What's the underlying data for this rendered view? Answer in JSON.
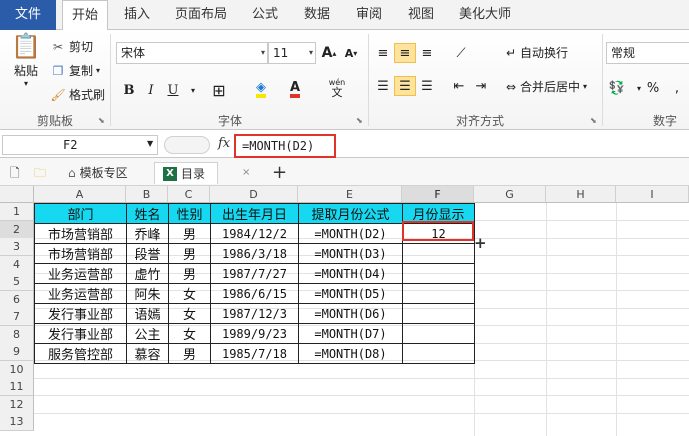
{
  "tabs": [
    "文件",
    "开始",
    "插入",
    "页面布局",
    "公式",
    "数据",
    "审阅",
    "视图",
    "美化大师"
  ],
  "clipboard": {
    "paste": "粘贴",
    "cut": "剪切",
    "copy": "复制",
    "format_painter": "格式刷",
    "label": "剪贴板"
  },
  "font": {
    "name": "宋体",
    "size": "11",
    "label": "字体",
    "bold": "B",
    "italic": "I",
    "underline": "U",
    "grow": "A",
    "shrink": "A",
    "wen": "wén"
  },
  "alignment": {
    "wrap": "自动换行",
    "merge": "合并后居中",
    "label": "对齐方式"
  },
  "number": {
    "format": "常规",
    "percent": "%",
    "comma": ",",
    "label": "数字"
  },
  "formula_bar": {
    "name_box": "F2",
    "fx": "fx",
    "formula": "=MONTH(D2)"
  },
  "doc_tabs": [
    "模板专区",
    "目录"
  ],
  "columns": [
    "A",
    "B",
    "C",
    "D",
    "E",
    "F",
    "G",
    "H",
    "I"
  ],
  "rows": [
    "1",
    "2",
    "3",
    "4",
    "5",
    "6",
    "7",
    "8",
    "9",
    "10",
    "11",
    "12",
    "13"
  ],
  "table": {
    "headers": [
      "部门",
      "姓名",
      "性别",
      "出生年月日",
      "提取月份公式",
      "月份显示"
    ],
    "rows": [
      [
        "市场营销部",
        "乔峰",
        "男",
        "1984/12/2",
        "=MONTH(D2)",
        "12"
      ],
      [
        "市场营销部",
        "段誉",
        "男",
        "1986/3/18",
        "=MONTH(D3)",
        ""
      ],
      [
        "业务运营部",
        "虚竹",
        "男",
        "1987/7/27",
        "=MONTH(D4)",
        ""
      ],
      [
        "业务运营部",
        "阿朱",
        "女",
        "1986/6/15",
        "=MONTH(D5)",
        ""
      ],
      [
        "发行事业部",
        "语嫣",
        "女",
        "1987/12/3",
        "=MONTH(D6)",
        ""
      ],
      [
        "发行事业部",
        "公主",
        "女",
        "1989/9/23",
        "=MONTH(D7)",
        ""
      ],
      [
        "服务管控部",
        "慕容",
        "男",
        "1985/7/18",
        "=MONTH(D8)",
        ""
      ]
    ]
  },
  "colors": {
    "file_tab": "#2a5caa",
    "header_fill": "#16d8f0",
    "highlight": "#e0332a"
  }
}
